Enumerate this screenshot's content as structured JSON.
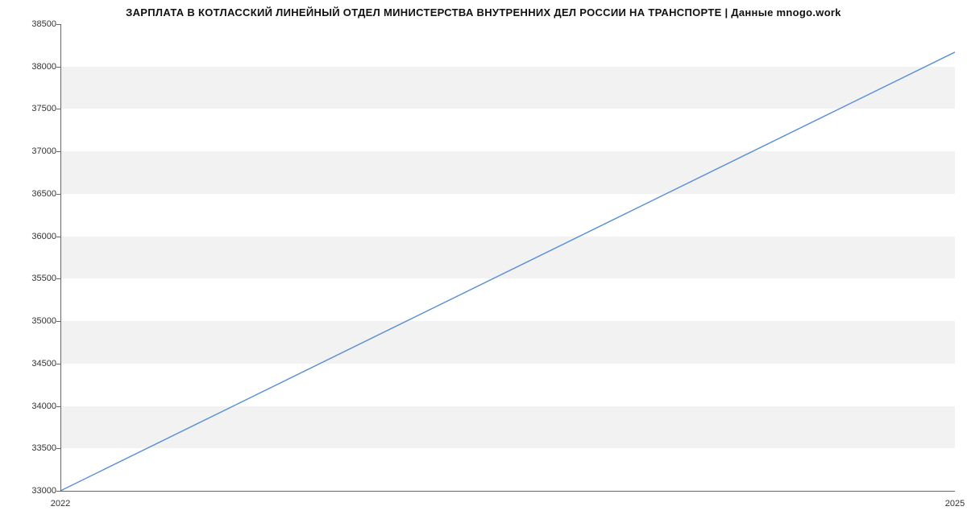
{
  "chart_data": {
    "type": "line",
    "title": "ЗАРПЛАТА В КОТЛАССКИЙ ЛИНЕЙНЫЙ ОТДЕЛ МИНИСТЕРСТВА ВНУТРЕННИХ ДЕЛ РОССИИ НА ТРАНСПОРТЕ | Данные mnogo.work",
    "x": [
      2022,
      2025
    ],
    "values": [
      33000,
      38170
    ],
    "xlabel": "",
    "ylabel": "",
    "xlim": [
      2022,
      2025
    ],
    "ylim": [
      33000,
      38500
    ],
    "x_ticks": [
      2022,
      2025
    ],
    "y_ticks": [
      33000,
      33500,
      34000,
      34500,
      35000,
      35500,
      36000,
      36500,
      37000,
      37500,
      38000,
      38500
    ],
    "line_color": "#5b8fd6",
    "grid_band_color": "#f2f2f2"
  }
}
